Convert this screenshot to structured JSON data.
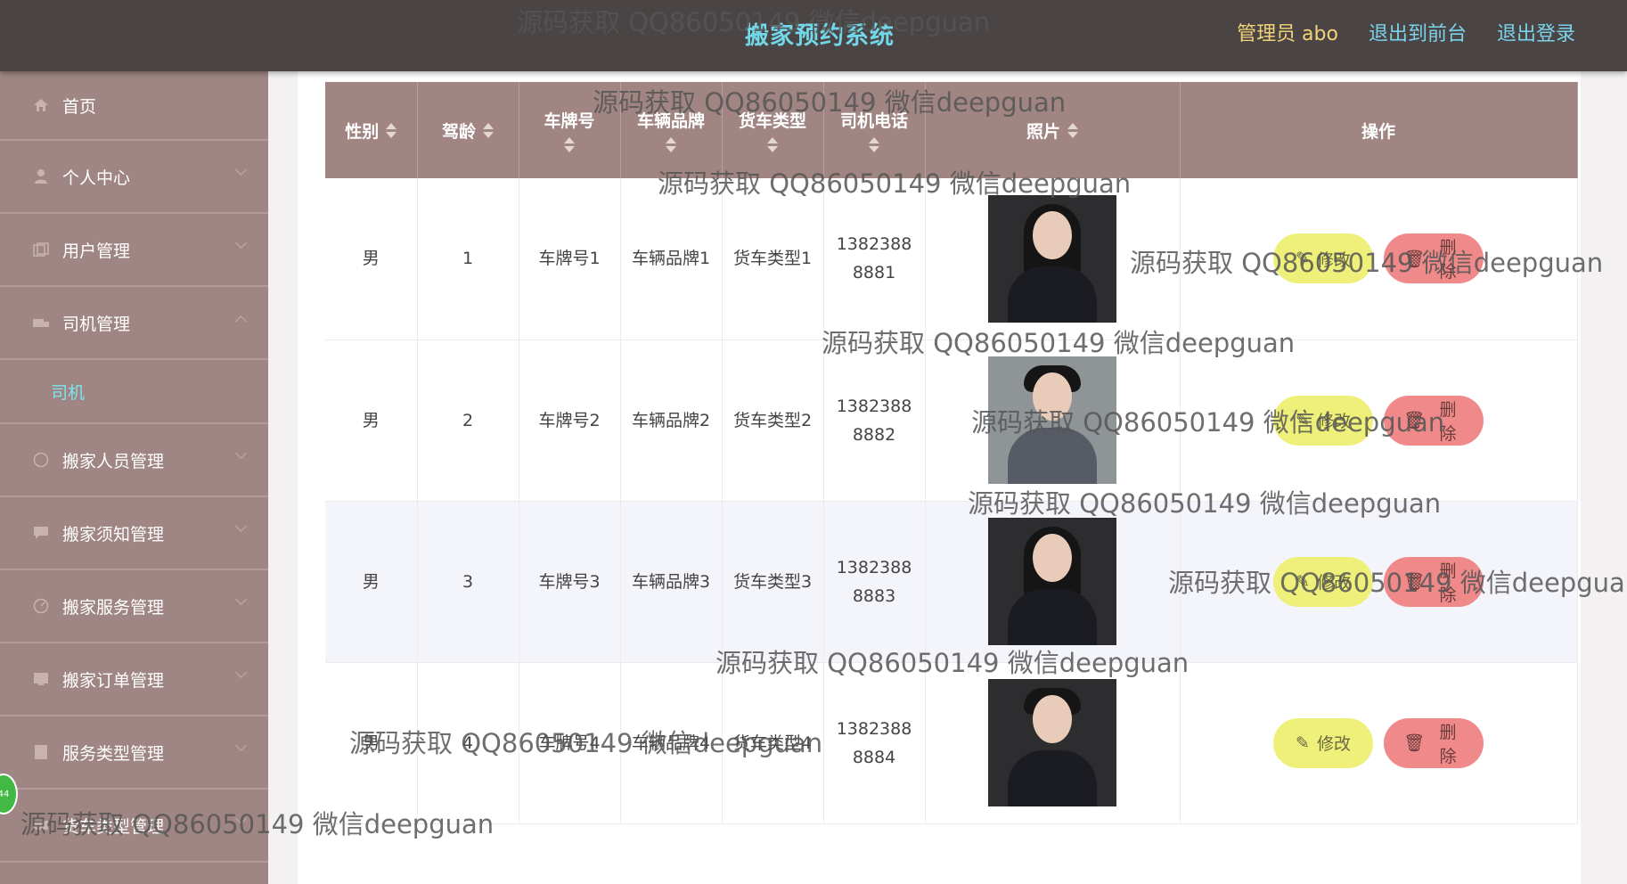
{
  "header": {
    "title": "搬家预约系统",
    "admin_label": "管理员 abo",
    "to_front": "退出到前台",
    "logout": "退出登录"
  },
  "sidebar": {
    "items": [
      {
        "label": "首页",
        "icon": "home-icon"
      },
      {
        "label": "个人中心",
        "icon": "user-icon"
      },
      {
        "label": "用户管理",
        "icon": "users-icon"
      },
      {
        "label": "司机管理",
        "icon": "truck-icon",
        "expanded": true
      },
      {
        "label": "搬家人员管理",
        "icon": "worker-icon"
      },
      {
        "label": "搬家须知管理",
        "icon": "notice-icon"
      },
      {
        "label": "搬家服务管理",
        "icon": "service-icon"
      },
      {
        "label": "搬家订单管理",
        "icon": "order-icon"
      },
      {
        "label": "服务类型管理",
        "icon": "category-icon"
      },
      {
        "label": "货车类型管理",
        "icon": "truck-type-icon"
      }
    ],
    "sub_item": "司机",
    "badge": "44"
  },
  "table": {
    "headers": [
      "性别",
      "驾龄",
      "车牌号",
      "车辆品牌",
      "货车类型",
      "司机电话",
      "照片",
      "操作"
    ],
    "rows": [
      {
        "gender": "男",
        "years": "1",
        "plate": "车牌号1",
        "brand": "车辆品牌1",
        "truck_type": "货车类型1",
        "phone": "13823888881"
      },
      {
        "gender": "男",
        "years": "2",
        "plate": "车牌号2",
        "brand": "车辆品牌2",
        "truck_type": "货车类型2",
        "phone": "13823888882"
      },
      {
        "gender": "男",
        "years": "3",
        "plate": "车牌号3",
        "brand": "车辆品牌3",
        "truck_type": "货车类型3",
        "phone": "13823888883"
      },
      {
        "gender": "男",
        "years": "4",
        "plate": "车牌号4",
        "brand": "车辆品牌4",
        "truck_type": "货车类型4",
        "phone": "13823888884"
      }
    ],
    "edit_label": "修改",
    "delete_label": "删除"
  },
  "watermark": "源码获取 QQ86050149 微信deepguan"
}
